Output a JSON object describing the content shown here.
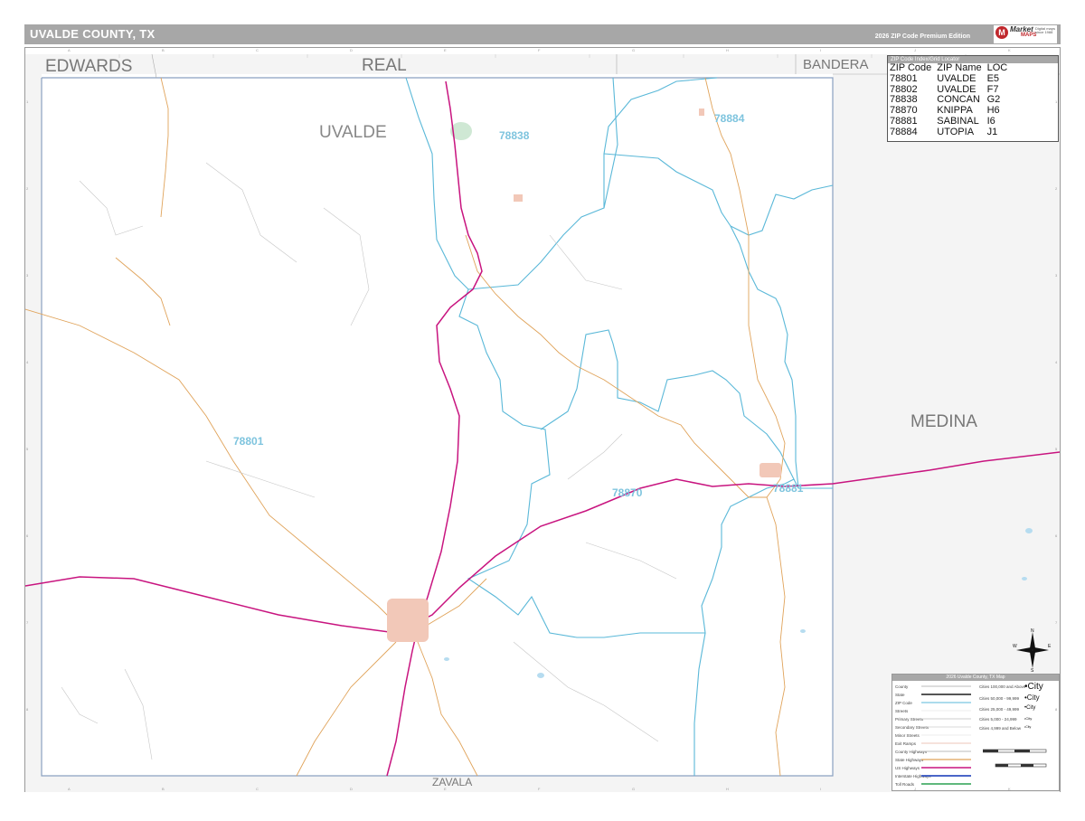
{
  "header": {
    "title": "UVALDE COUNTY, TX",
    "edition": "2026 ZIP Code Premium Edition",
    "logo": {
      "mark": "M",
      "line1": "Market",
      "line2": "MAPS",
      "fine": "Digital maps since 1988"
    }
  },
  "grid": {
    "columns": [
      "A",
      "B",
      "C",
      "D",
      "E",
      "F",
      "G",
      "H",
      "I",
      "J",
      "K"
    ],
    "rows": [
      "1",
      "2",
      "3",
      "4",
      "5",
      "6",
      "7",
      "8"
    ]
  },
  "counties": {
    "main": "UVALDE",
    "neighbors": [
      "EDWARDS",
      "REAL",
      "BANDERA",
      "MEDINA",
      "ZAVALA"
    ]
  },
  "zip_labels": [
    "78884",
    "78838",
    "78801",
    "78870",
    "78881"
  ],
  "zip_index": {
    "heading": "ZIP Code Index/Grid Locator",
    "columns": [
      "ZIP Code",
      "ZIP Name",
      "LOC"
    ],
    "rows": [
      [
        "78801",
        "UVALDE",
        "E5"
      ],
      [
        "78802",
        "UVALDE",
        "F7"
      ],
      [
        "78838",
        "CONCAN",
        "G2"
      ],
      [
        "78870",
        "KNIPPA",
        "H6"
      ],
      [
        "78881",
        "SABINAL",
        "I6"
      ],
      [
        "78884",
        "UTOPIA",
        "J1"
      ]
    ]
  },
  "legend": {
    "title": "2026 Uvalde County, TX Map",
    "items": [
      "County",
      "State",
      "ZIP Code",
      "Streets",
      "Primary Streets",
      "Secondary Streets",
      "Minor Streets",
      "Exit Ramps",
      "County Highways",
      "State Highways",
      "US Highways",
      "Interstate Highways",
      "Toll Roads"
    ],
    "city_sizes": [
      "Cities 100,000 and Above",
      "Cities 50,000 - 99,999",
      "Cities 25,000 - 49,999",
      "Cities 5,000 - 24,999",
      "Cities 4,999 and Below"
    ],
    "city_symbols": [
      "•City",
      "•City",
      "•City",
      "•City",
      "•City"
    ]
  },
  "compass": {
    "n": "N",
    "e": "E",
    "s": "S",
    "w": "W"
  },
  "colors": {
    "zip_boundary": "#5ab8d8",
    "us_highway": "#c8147f",
    "state_highway": "#e0a35a",
    "county_line": "#8aa0c0",
    "water": "#b6dcf0",
    "city": "#f2c8b8",
    "neighbor_fill": "#f4f4f4"
  }
}
